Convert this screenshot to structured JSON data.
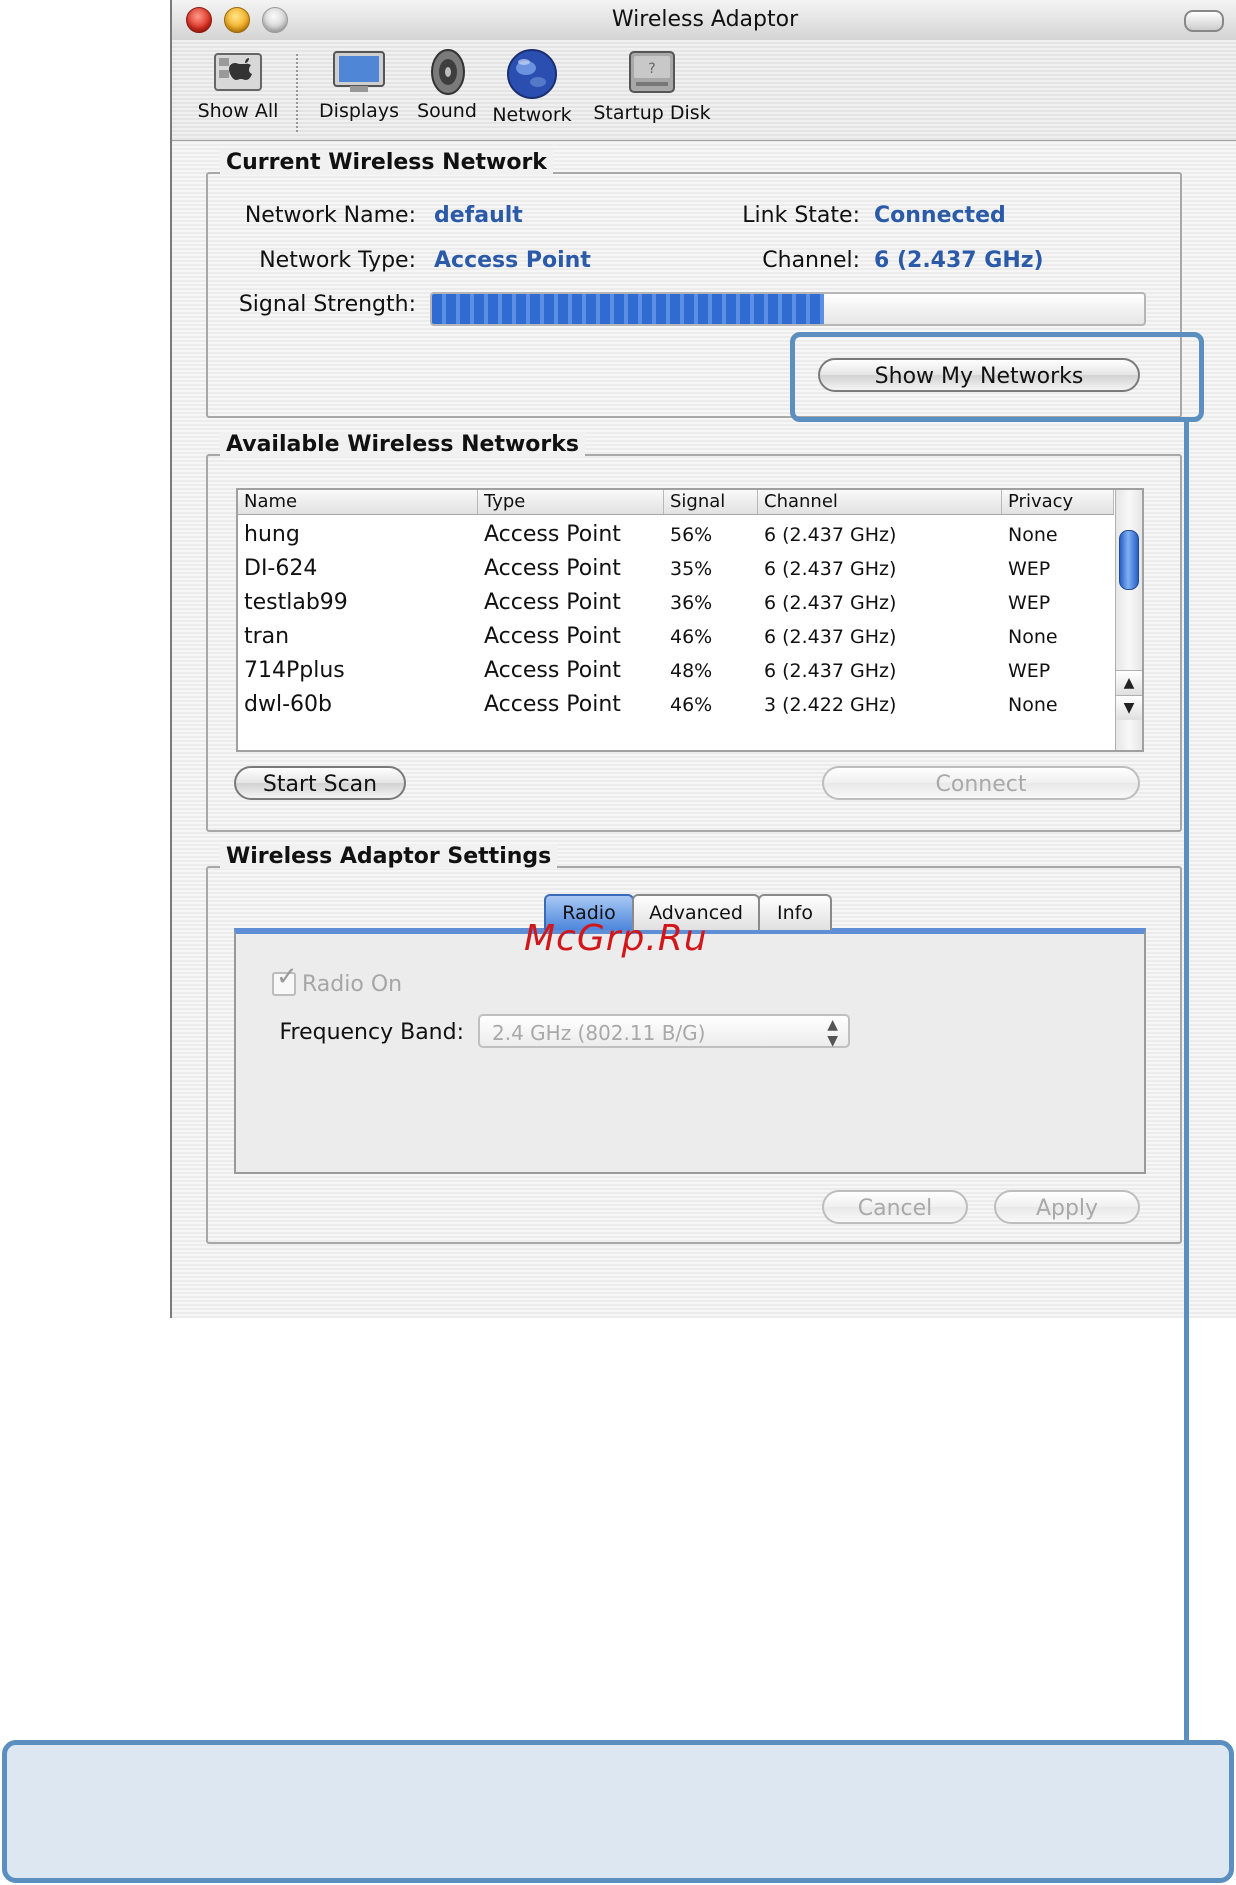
{
  "window": {
    "title": "Wireless Adaptor"
  },
  "toolbar": {
    "items": [
      {
        "label": "Show All",
        "icon": "apple-show-all-icon"
      },
      {
        "label": "Displays",
        "icon": "monitor-icon"
      },
      {
        "label": "Sound",
        "icon": "speaker-icon"
      },
      {
        "label": "Network",
        "icon": "globe-icon"
      },
      {
        "label": "Startup Disk",
        "icon": "hard-disk-icon"
      }
    ]
  },
  "current": {
    "title": "Current Wireless Network",
    "network_name_label": "Network Name:",
    "network_name": "default",
    "link_state_label": "Link State:",
    "link_state": "Connected",
    "network_type_label": "Network Type:",
    "network_type": "Access Point",
    "channel_label": "Channel:",
    "channel": "6 (2.437 GHz)",
    "signal_label": "Signal Strength:",
    "signal_level": 0.55,
    "show_networks_button": "Show My Networks"
  },
  "available": {
    "title": "Available Wireless Networks",
    "columns": [
      "Name",
      "Type",
      "Signal",
      "Channel",
      "Privacy"
    ],
    "rows": [
      [
        "hung",
        "Access Point",
        "56%",
        "6 (2.437 GHz)",
        "None"
      ],
      [
        "DI-624",
        "Access Point",
        "35%",
        "6 (2.437 GHz)",
        "WEP"
      ],
      [
        "testlab99",
        "Access Point",
        "36%",
        "6 (2.437 GHz)",
        "WEP"
      ],
      [
        "tran",
        "Access Point",
        "46%",
        "6 (2.437 GHz)",
        "None"
      ],
      [
        "714Pplus",
        "Access Point",
        "48%",
        "6 (2.437 GHz)",
        "WEP"
      ],
      [
        "dwl-60b",
        "Access Point",
        "46%",
        "3 (2.422 GHz)",
        "None"
      ]
    ],
    "start_scan_button": "Start Scan",
    "connect_button": "Connect"
  },
  "settings": {
    "title": "Wireless Adaptor Settings",
    "tabs": [
      "Radio",
      "Advanced",
      "Info"
    ],
    "active_tab": "Radio",
    "radio_on_label": "Radio On",
    "radio_on_checked": true,
    "frequency_label": "Frequency Band:",
    "frequency_value": "2.4 GHz (802.11 B/G)",
    "cancel_button": "Cancel",
    "apply_button": "Apply"
  },
  "watermark": "McGrp.Ru",
  "colors": {
    "value_blue": "#2a5aa8",
    "callout_blue": "#5b8fc0",
    "note_fill": "#dde7f2",
    "watermark_red": "#d2171a"
  }
}
